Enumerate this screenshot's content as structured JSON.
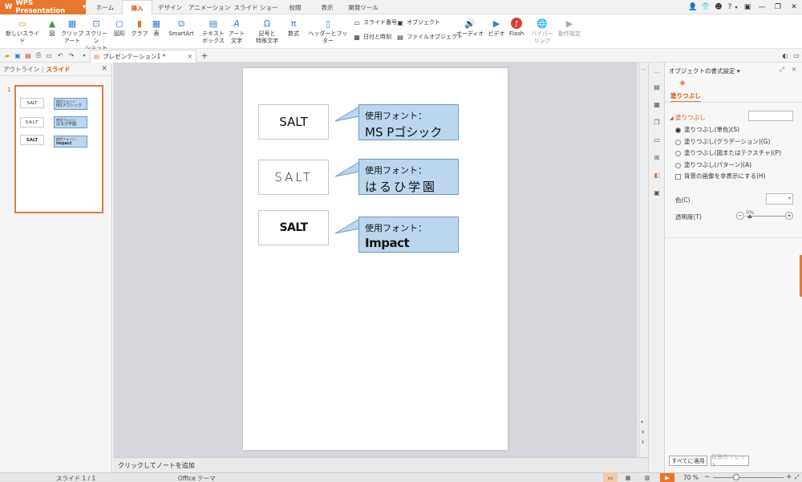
{
  "app": {
    "title": "WPS Presentation"
  },
  "tabs": [
    "ホーム",
    "挿入",
    "デザイン",
    "アニメーション",
    "スライド ショー",
    "校閲",
    "表示",
    "開発ツール"
  ],
  "active_tab": "挿入",
  "ribbon": {
    "new_slide": "新しいスライド",
    "picture": "図",
    "clipart": "クリップ\nアート",
    "screenshot": "スクリーン\nショット",
    "shape": "図形",
    "chart": "グラフ",
    "table": "表",
    "smartart": "SmartArt",
    "textbox": "テキスト\nボックス",
    "wordart": "アート\n文字",
    "symbol": "記号と\n特殊文字",
    "equation": "数式",
    "header_footer": "ヘッダーとフッター",
    "slide_number": "スライド番号",
    "object": "オブジェクト",
    "datetime": "日付と時刻",
    "file_object": "ファイルオブジェクト",
    "audio": "オーディオ",
    "video": "ビデオ",
    "flash": "Flash",
    "hyperlink": "ハイパー\nリンク",
    "action": "動作設定"
  },
  "document_tab": "プレゼンテーション1 *",
  "left_panel": {
    "outline_tab": "アウトライン",
    "slides_tab": "スライド",
    "slide_index": "1"
  },
  "slide": {
    "items": [
      {
        "word": "SALT",
        "label": "使用フォント：",
        "font": "MS Pゴシック"
      },
      {
        "word": "SALT",
        "label": "使用フォント：",
        "font": "はるひ学園"
      },
      {
        "word": "SALT",
        "label": "使用フォント：",
        "font": "Impact"
      }
    ]
  },
  "notes_placeholder": "クリックしてノートを追加",
  "properties": {
    "title": "オブジェクトの書式設定",
    "fill_tab": "塗りつぶし",
    "section": "塗りつぶし",
    "options": [
      "塗りつぶし(単色)(S)",
      "塗りつぶし(グラデーション)(G)",
      "塗りつぶし(図またはテクスチャ)(P)",
      "塗りつぶし(パターン)(A)"
    ],
    "checkbox": "背景の画像を非表示にする(H)",
    "color_label": "色(C)",
    "transparency_label": "透明度(T)",
    "transparency_value": "0%",
    "apply_all": "すべてに適用",
    "reset_bg": "背景のリセット"
  },
  "status": {
    "slide": "スライド 1 / 1",
    "theme": "Office テーマ",
    "zoom": "70 %"
  },
  "colors": {
    "accent": "#e8762d",
    "callout_fill": "#bcd6ee",
    "callout_border": "#6c9bc7"
  }
}
